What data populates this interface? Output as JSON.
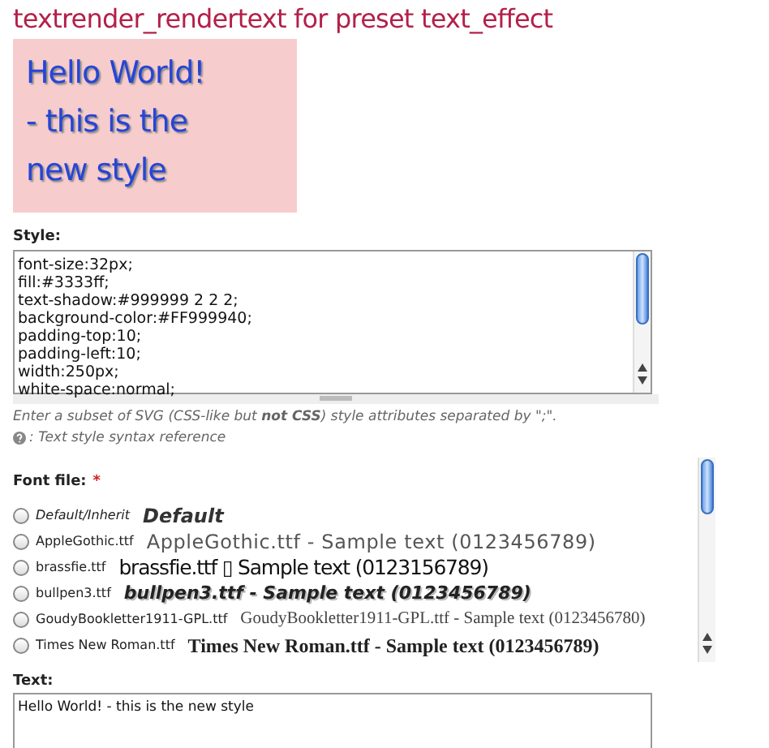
{
  "title": "textrender_rendertext for preset text_effect",
  "preview": {
    "lines": [
      "Hello World!",
      "- this is the",
      "new style"
    ]
  },
  "style_field": {
    "label": "Style:",
    "lines": [
      "font-size:32px;",
      "fill:#3333ff;",
      "text-shadow:#999999 2 2 2;",
      "background-color:#FF999940;",
      "padding-top:10;",
      "padding-left:10;",
      "width:250px;",
      "white-space:normal;"
    ],
    "help": "Enter a subset of SVG (CSS-like but **not CSS**) style attributes separated by \";\".",
    "reference_link": ": Text style syntax reference"
  },
  "font_file": {
    "label": "Font file:",
    "required_mark": "*",
    "options": [
      {
        "file": "Default/Inherit",
        "sample": "Default",
        "kind": "default",
        "selected": false
      },
      {
        "file": "AppleGothic.ttf",
        "sample": "AppleGothic.ttf - Sample text (0123456789)",
        "kind": "rounded",
        "selected": false
      },
      {
        "file": "brassfie.ttf",
        "sample": "brassfie.ttf ▯ Sample text (0123156789)",
        "kind": "condensed",
        "selected": false
      },
      {
        "file": "bullpen3.ttf",
        "sample": "bullpen3.ttf - Sample text (0123456789)",
        "kind": "outlined",
        "selected": false
      },
      {
        "file": "GoudyBookletter1911-GPL.ttf",
        "sample": "GoudyBookletter1911-GPL.ttf - Sample text (0123456780)",
        "kind": "oldstyle",
        "selected": false
      },
      {
        "file": "Times New Roman.ttf",
        "sample": "Times New Roman.ttf - Sample text (0123456789)",
        "kind": "serif",
        "selected": false
      }
    ]
  },
  "text_field": {
    "label": "Text:",
    "value": "Hello World! - this is the new style"
  }
}
